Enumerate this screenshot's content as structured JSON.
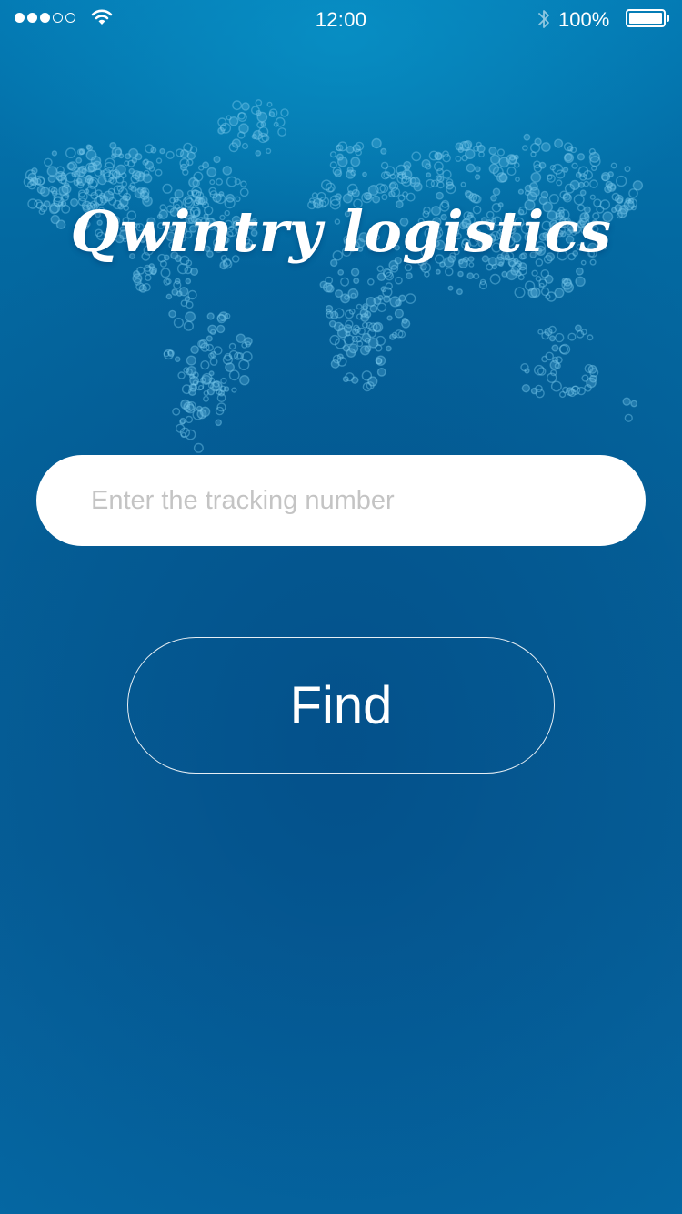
{
  "status_bar": {
    "signal_strength": 3,
    "signal_max": 5,
    "time": "12:00",
    "battery_percent": "100%",
    "icons": [
      "wifi-icon",
      "bluetooth-icon",
      "battery-icon"
    ]
  },
  "app": {
    "title": "Qwintry logistics",
    "background_map": "world-map-dots"
  },
  "tracking": {
    "value": "",
    "placeholder": "Enter the tracking number"
  },
  "find_button": {
    "label": "Find"
  },
  "colors": {
    "background_top": "#0479b3",
    "background_bottom": "#05629a",
    "text": "#ffffff",
    "input_background": "#ffffff",
    "placeholder": "#c4c4c4"
  }
}
